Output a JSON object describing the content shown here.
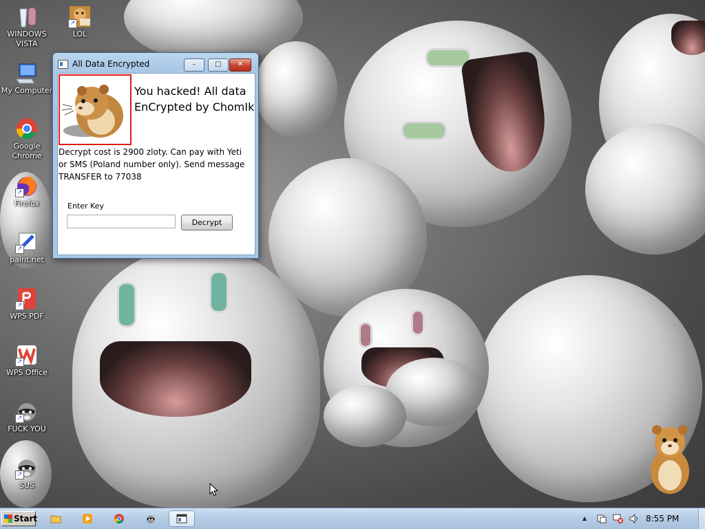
{
  "desktop_icons": [
    {
      "label": "WINDOWS VISTA",
      "icon": "recycle-bin-icon"
    },
    {
      "label": "LOL",
      "icon": "hamster-icon"
    },
    {
      "label": "My Computer",
      "icon": "computer-icon"
    },
    {
      "label": "Google Chrome",
      "icon": "chrome-icon"
    },
    {
      "label": "Firefox",
      "icon": "firefox-icon"
    },
    {
      "label": "paint.net",
      "icon": "paintnet-icon"
    },
    {
      "label": "WPS PDF",
      "icon": "wps-pdf-icon"
    },
    {
      "label": "WPS Office",
      "icon": "wps-office-icon"
    },
    {
      "label": "FUCK YOU",
      "icon": "raccoon-icon"
    },
    {
      "label": "SUS",
      "icon": "raccoon-icon"
    }
  ],
  "dialog": {
    "title": "All Data Encrypted",
    "headline": "You hacked! All data EnCrypted by ChomIk",
    "body": "Decrypt cost is 2900 zloty. Can pay with Yeti or SMS (Poland number only). Send message TRANSFER to 77038",
    "key_label": "Enter Key",
    "key_value": "",
    "key_placeholder": "",
    "decrypt_label": "Decrypt",
    "minimize_symbol": "–",
    "maximize_symbol": "□",
    "close_symbol": "✕"
  },
  "taskbar": {
    "start_label": "Start",
    "apps": [
      {
        "name": "file-explorer",
        "icon": "folder-icon"
      },
      {
        "name": "media-player",
        "icon": "media-player-icon"
      },
      {
        "name": "chrome",
        "icon": "chrome-icon"
      },
      {
        "name": "raccoon-app",
        "icon": "raccoon-icon"
      },
      {
        "name": "encryption-window",
        "icon": "window-app-icon",
        "active": true
      }
    ],
    "tray": {
      "show_hidden_symbol": "▲",
      "clock": "8:55 PM"
    }
  },
  "colors": {
    "dialog_border_accent": "#e21a1a",
    "close_button": "#c9432d",
    "taskbar": "#b6cde6"
  }
}
